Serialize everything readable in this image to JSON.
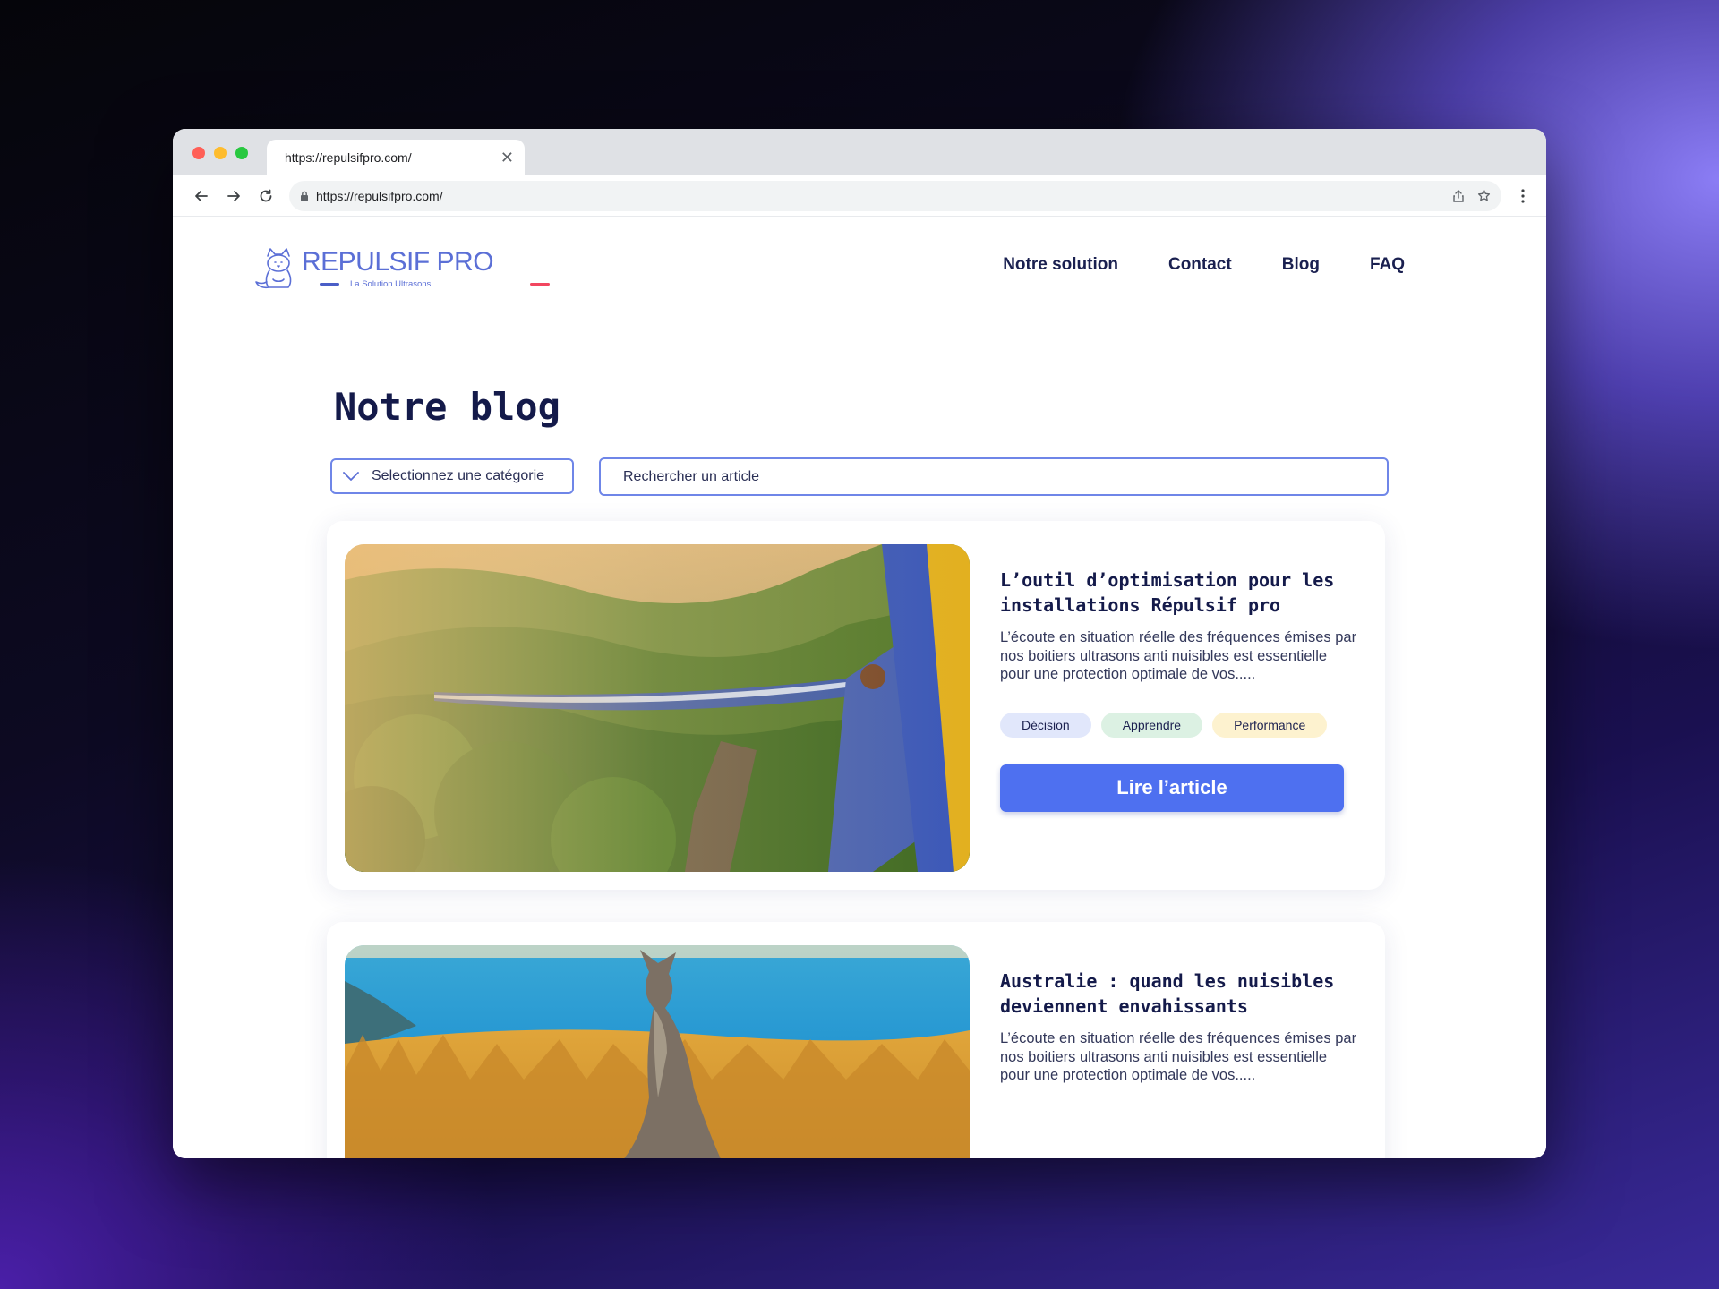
{
  "browser": {
    "tab_title": "https://repulsifpro.com/",
    "url": "https://repulsifpro.com/"
  },
  "site": {
    "logo_text": "REPULSIF PRO",
    "logo_tagline": "La Solution Ultrasons",
    "nav": [
      "Notre solution",
      "Contact",
      "Blog",
      "FAQ"
    ]
  },
  "blog": {
    "title": "Notre blog",
    "category_select": "Selectionnez une catégorie",
    "search_placeholder": "Rechercher un article"
  },
  "articles": [
    {
      "title": "L’outil d’optimisation pour les installations Répulsif pro",
      "excerpt": "L’écoute en situation réelle des fréquences émises par nos boitiers ultrasons anti nuisibles est essentielle pour une protection optimale de vos.....",
      "tags": [
        "Décision",
        "Apprendre",
        "Performance"
      ],
      "cta": "Lire l’article",
      "image": "train-mountain-photo"
    },
    {
      "title": "Australie : quand les nuisibles deviennent envahissants",
      "excerpt": "L’écoute en situation réelle des fréquences émises par nos boitiers ultrasons anti nuisibles est essentielle pour une protection optimale de vos.....",
      "image": "kangaroo-photo"
    }
  ],
  "colors": {
    "accent": "#4e70f0",
    "heading": "#141a4a",
    "tag_decision": "#e1e7fb",
    "tag_apprendre": "#dcf1e3",
    "tag_performance": "#fdf2cf"
  }
}
